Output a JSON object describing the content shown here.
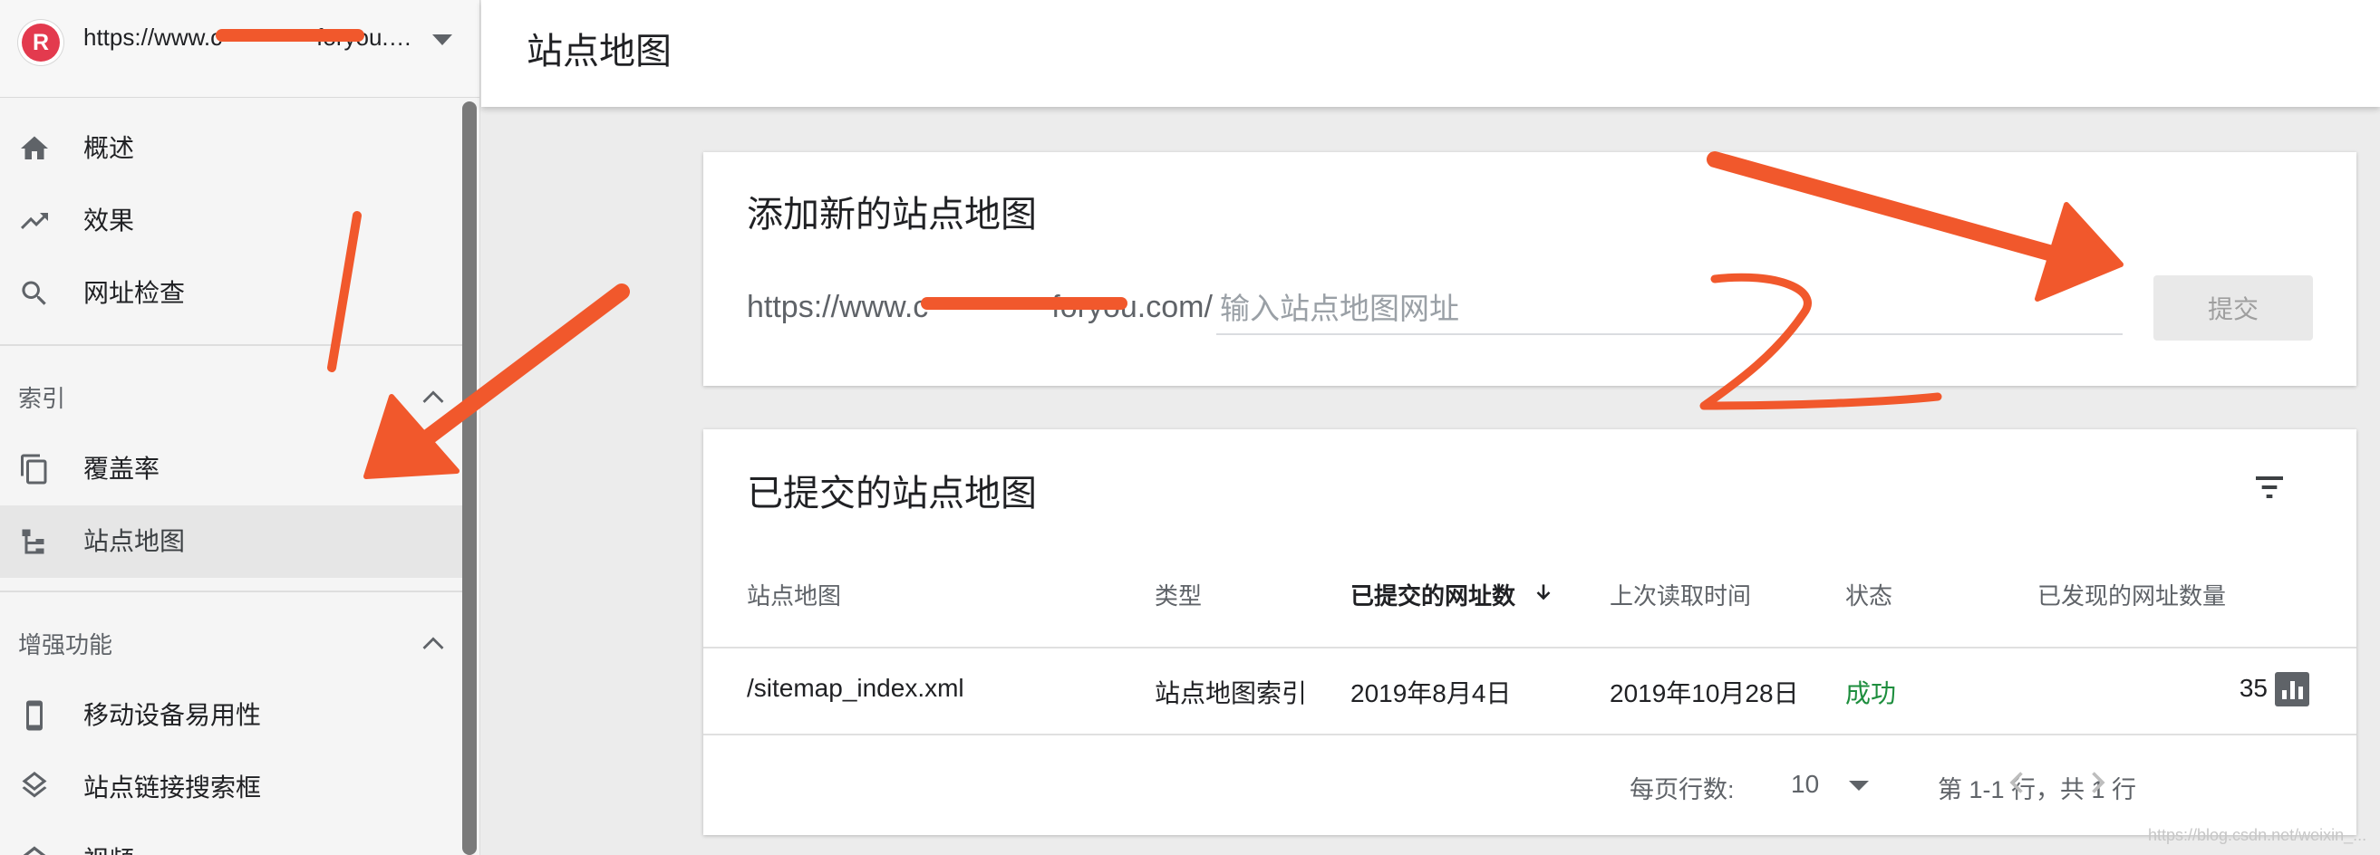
{
  "property": {
    "logo_letter": "R",
    "url": "https://www.c    foryou.…"
  },
  "nav": {
    "overview": "概述",
    "performance": "效果",
    "url_inspection": "网址检查",
    "index_section": "索引",
    "coverage": "覆盖率",
    "sitemaps": "站点地图",
    "enhancements_section": "增强功能",
    "mobile_usability": "移动设备易用性",
    "sitelinks_searchbox": "站点链接搜索框",
    "videos": "视频"
  },
  "page": {
    "title": "站点地图"
  },
  "add_card": {
    "title": "添加新的站点地图",
    "url_prefix": "https://www.c    foryou.com/",
    "input_placeholder": "输入站点地图网址",
    "submit_label": "提交"
  },
  "submitted_card": {
    "title": "已提交的站点地图",
    "columns": {
      "sitemap": "站点地图",
      "type": "类型",
      "submitted_urls": "已提交的网址数",
      "last_read": "上次读取时间",
      "status": "状态",
      "discovered_urls": "已发现的网址数量"
    },
    "rows": [
      {
        "sitemap": "/sitemap_index.xml",
        "type": "站点地图索引",
        "submitted": "2019年8月4日",
        "last_read": "2019年10月28日",
        "status": "成功",
        "discovered": "35"
      }
    ],
    "pagination": {
      "rows_per_page_label": "每页行数:",
      "rows_per_page_value": "10",
      "range_text": "第 1-1 行，共 1 行"
    }
  },
  "watermark": "https://blog.csdn.net/weixin_...",
  "colors": {
    "annotation": "#f1582c",
    "success": "#1e8e3e",
    "logo": "#e33a4e"
  }
}
